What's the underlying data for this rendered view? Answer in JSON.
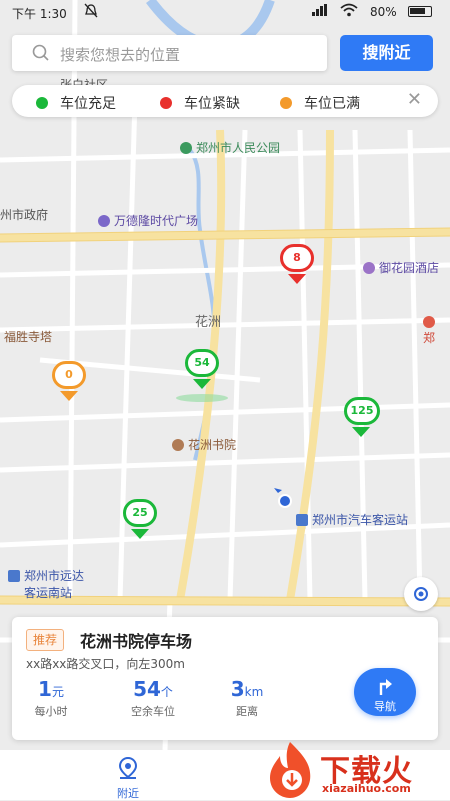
{
  "status_bar": {
    "time": "下午 1:30",
    "battery": "80%"
  },
  "search": {
    "placeholder": "搜索您想去的位置",
    "button_label": "搜附近"
  },
  "legend": {
    "items": [
      {
        "label": "车位充足",
        "color": "#1bb83a"
      },
      {
        "label": "车位紧缺",
        "color": "#e8302c"
      },
      {
        "label": "车位已满",
        "color": "#f39a2b"
      }
    ]
  },
  "map_labels": {
    "people_park": "郑州市人民公园",
    "city_gov": "州市政府",
    "wanda": "万德隆时代广场",
    "yuhua_hotel": "御花园酒店",
    "fusheng": "福胜寺塔",
    "huazhou": "花洲",
    "huazhou_academy": "花洲书院",
    "bus_station": "郑州市汽车客运站",
    "yuanda_line1": "郑州市远达",
    "yuanda_line2": "客运南站",
    "top_area": "张白社区",
    "partial_right": "郑"
  },
  "markers": [
    {
      "value": "8",
      "status": "紧缺",
      "color": "#e8302c"
    },
    {
      "value": "54",
      "status": "充足",
      "color": "#1bb83a"
    },
    {
      "value": "0",
      "status": "已满",
      "color": "#f39a2b"
    },
    {
      "value": "125",
      "status": "充足",
      "color": "#1bb83a"
    },
    {
      "value": "25",
      "status": "充足",
      "color": "#1bb83a"
    }
  ],
  "card": {
    "badge": "推荐",
    "title": "花洲书院停车场",
    "address": "xx路xx路交叉口，向左300m",
    "price_value": "1",
    "price_unit": "元",
    "price_label": "每小时",
    "spaces_value": "54",
    "spaces_unit": "个",
    "spaces_label": "空余车位",
    "distance_value": "3",
    "distance_unit": "km",
    "distance_label": "距离",
    "nav_label": "导航"
  },
  "tabbar": {
    "nearby_label": "附近"
  },
  "watermark": {
    "brand": "下载火",
    "url": "xiazaihuo.com"
  }
}
